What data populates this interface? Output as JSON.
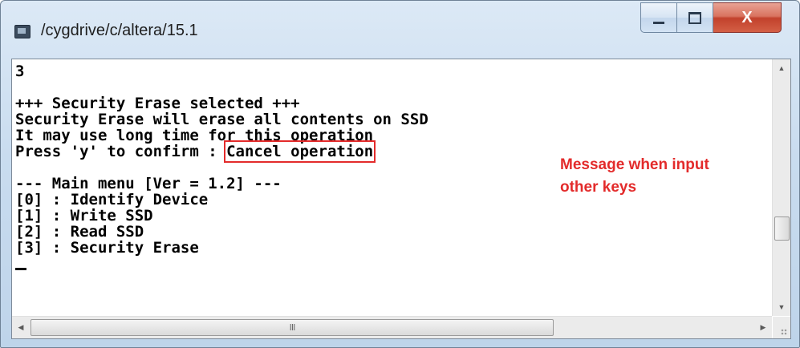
{
  "window": {
    "title": "/cygdrive/c/altera/15.1",
    "controls": {
      "minimize_icon": "minimize-icon",
      "maximize_icon": "maximize-icon",
      "close_label": "X"
    }
  },
  "terminal": {
    "lines": [
      "3",
      "",
      "+++ Security Erase selected +++",
      "Security Erase will erase all contents on SSD",
      "It may use long time for this operation",
      "Press 'y' to confirm : ",
      "",
      "--- Main menu [Ver = 1.2] ---",
      "[0] : Identify Device",
      "[1] : Write SSD",
      "[2] : Read SSD",
      "[3] : Security Erase"
    ],
    "highlighted_text": "Cancel operation",
    "cursor": "_"
  },
  "annotation": {
    "line1": "Message when input",
    "line2": "other keys",
    "color": "#e32b2b"
  },
  "scrollbars": {
    "up_arrow": "▲",
    "down_arrow": "▼",
    "left_arrow": "◀",
    "right_arrow": "▶",
    "grip": "III"
  }
}
